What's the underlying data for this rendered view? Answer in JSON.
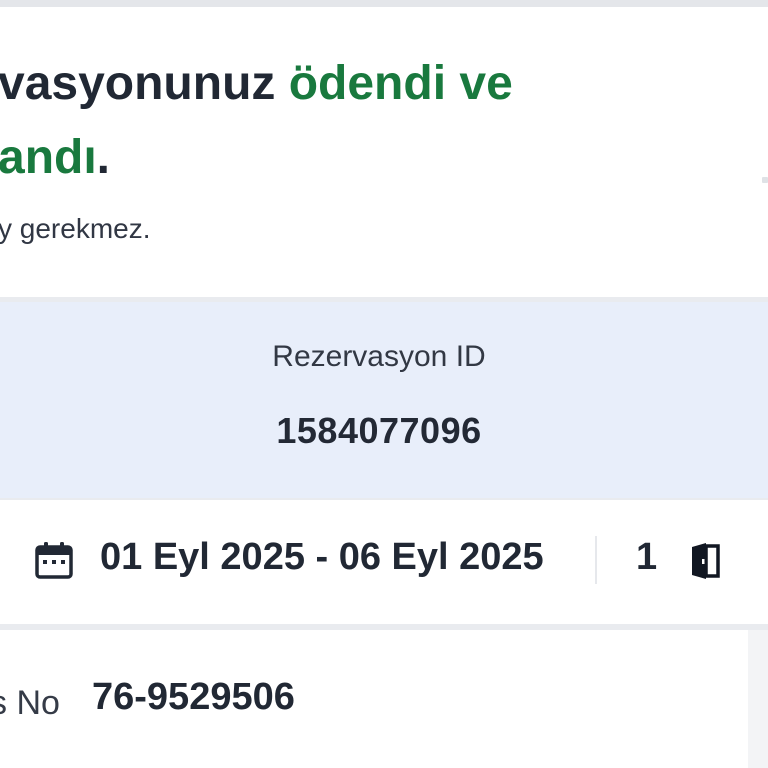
{
  "header": {
    "title_part1": "vasyonunuz ",
    "title_part2_green": "ödendi ve",
    "title_line2_green": "andı",
    "title_line2_end": ".",
    "subtitle": "y gerekmez."
  },
  "reservation": {
    "id_label": "Rezervasyon ID",
    "id_value": "1584077096"
  },
  "stay": {
    "calendar_icon": "calendar-icon",
    "dates": "01 Eyl 2025 - 06 Eyl 2025",
    "rooms": "1",
    "room_icon": "door-icon"
  },
  "confirmation": {
    "label": "s No",
    "value": "76-9529506"
  },
  "colors": {
    "accent_green": "#19793e",
    "id_box_bg": "#e8eefa",
    "text_dark": "#212834"
  }
}
